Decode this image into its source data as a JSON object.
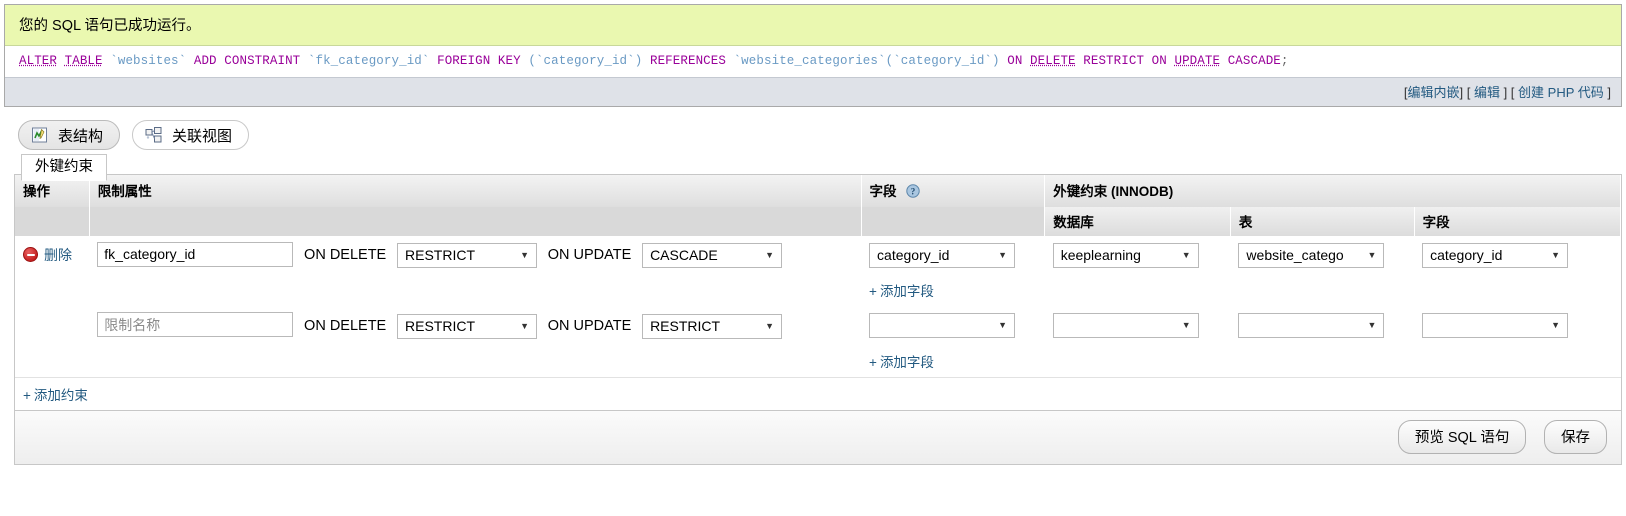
{
  "sql_result": {
    "success_message": "您的 SQL 语句已成功运行。",
    "query_tokens": [
      {
        "text": "ALTER",
        "type": "kw-u"
      },
      {
        "text": " ",
        "type": "plain"
      },
      {
        "text": "TABLE",
        "type": "kw-u"
      },
      {
        "text": " `websites` ",
        "type": "ident"
      },
      {
        "text": "ADD CONSTRAINT",
        "type": "kw"
      },
      {
        "text": " `fk_category_id` ",
        "type": "ident"
      },
      {
        "text": "FOREIGN KEY",
        "type": "kw"
      },
      {
        "text": " (`category_id`) ",
        "type": "ident"
      },
      {
        "text": "REFERENCES",
        "type": "kw"
      },
      {
        "text": " `website_categories`(`category_id`) ",
        "type": "ident"
      },
      {
        "text": "ON ",
        "type": "kw"
      },
      {
        "text": "DELETE",
        "type": "kw-u"
      },
      {
        "text": " RESTRICT ON ",
        "type": "kw"
      },
      {
        "text": "UPDATE",
        "type": "kw-u"
      },
      {
        "text": " CASCADE",
        "type": "kw"
      },
      {
        "text": ";",
        "type": "punc"
      }
    ],
    "query_plain": "ALTER TABLE `websites` ADD CONSTRAINT `fk_category_id` FOREIGN KEY (`category_id`) REFERENCES `website_categories`(`category_id`) ON DELETE RESTRICT ON UPDATE CASCADE;",
    "links": [
      {
        "label": "编辑内嵌",
        "open": "[",
        "close": "]"
      },
      {
        "label": "编辑",
        "open": "[ ",
        "close": " ]"
      },
      {
        "label": "创建 PHP 代码",
        "open": "[ ",
        "close": " ]"
      }
    ]
  },
  "top_tabs": [
    {
      "label": "表结构",
      "icon": "table-structure-icon",
      "active": true
    },
    {
      "label": "关联视图",
      "icon": "relation-view-icon",
      "active": false
    }
  ],
  "panel": {
    "legend": "外键约束",
    "headers": {
      "action": "操作",
      "constraint_properties": "限制属性",
      "field": "字段",
      "field_help_icon": "help-icon",
      "foreign_key_constraint": "外键约束 (INNODB)",
      "sub_database": "数据库",
      "sub_table": "表",
      "sub_column": "字段"
    },
    "rows": [
      {
        "delete_label": "删除",
        "delete_icon": "delete-minus-icon",
        "constraint_name": "fk_category_id",
        "constraint_name_placeholder": "",
        "on_delete_label": "ON DELETE",
        "on_delete_value": "RESTRICT",
        "on_update_label": "ON UPDATE",
        "on_update_value": "CASCADE",
        "field_value": "category_id",
        "database_value": "keeplearning",
        "table_value": "website_catego",
        "column_value": "category_id",
        "add_field_label": "添加字段"
      },
      {
        "delete_label": "",
        "constraint_name": "",
        "constraint_name_placeholder": "限制名称",
        "on_delete_label": "ON DELETE",
        "on_delete_value": "RESTRICT",
        "on_update_label": "ON UPDATE",
        "on_update_value": "RESTRICT",
        "field_value": "",
        "database_value": "",
        "table_value": "",
        "column_value": "",
        "add_field_label": "添加字段"
      }
    ],
    "add_constraint_label": "添加约束"
  },
  "footer": {
    "preview_sql_label": "预览 SQL 语句",
    "save_label": "保存"
  },
  "colors": {
    "success_bg": "#eaf8b0",
    "link": "#235a81",
    "keyword": "#990099",
    "identifier": "#6a9ac4",
    "delete_icon": "#c41e1e"
  }
}
